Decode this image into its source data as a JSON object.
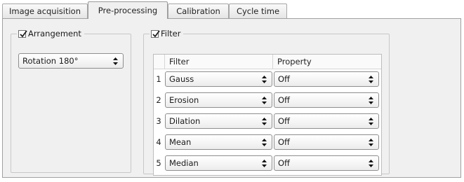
{
  "tabs": [
    {
      "label": "Image acquisition",
      "active": false
    },
    {
      "label": "Pre-processing",
      "active": true
    },
    {
      "label": "Calibration",
      "active": false
    },
    {
      "label": "Cycle time",
      "active": false
    }
  ],
  "arrangement": {
    "title": "Arrangement",
    "checked": true,
    "value": "Rotation 180°"
  },
  "filter_group": {
    "title": "Filter",
    "checked": true,
    "columns": [
      "Filter",
      "Property"
    ],
    "rows": [
      {
        "index": "1",
        "filter": "Gauss",
        "property": "Off"
      },
      {
        "index": "2",
        "filter": "Erosion",
        "property": "Off"
      },
      {
        "index": "3",
        "filter": "Dilation",
        "property": "Off"
      },
      {
        "index": "4",
        "filter": "Mean",
        "property": "Off"
      },
      {
        "index": "5",
        "filter": "Median",
        "property": "Off"
      }
    ]
  },
  "colors": {
    "pane": "#f0f0f0",
    "border": "#a0a0a0",
    "check": "#1f1f1f"
  }
}
